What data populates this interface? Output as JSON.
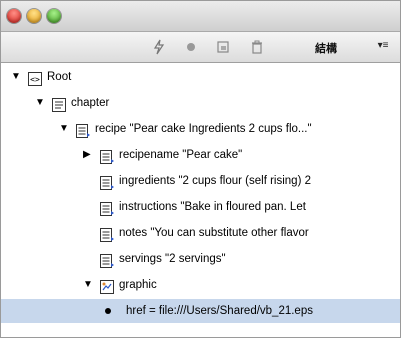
{
  "window": {
    "traffic_lights": [
      "close",
      "minimize",
      "zoom"
    ]
  },
  "toolbar": {
    "buttons": [
      "lightning-icon",
      "record-icon",
      "window-icon",
      "trash-icon"
    ],
    "structure_label": "結構",
    "menu_label": "▾≡"
  },
  "tree": {
    "rows": [
      {
        "label": "Root",
        "icon": "xml-icon",
        "expanded": true
      },
      {
        "label": "chapter",
        "icon": "doc-ab-icon",
        "expanded": true
      },
      {
        "label": "recipe  \"Pear cake Ingredients 2 cups flo...\"",
        "icon": "element-icon",
        "expanded": true
      },
      {
        "label": "recipename  \"Pear cake\"",
        "icon": "element-icon",
        "expanded": false
      },
      {
        "label": "ingredients  \"2 cups flour (self rising) 2",
        "icon": "element-icon"
      },
      {
        "label": "instructions  \"Bake in floured pan. Let",
        "icon": "element-icon"
      },
      {
        "label": "notes  \"You can substitute other flavor",
        "icon": "element-icon"
      },
      {
        "label": "servings  \"2 servings\"",
        "icon": "element-icon"
      },
      {
        "label": "graphic",
        "icon": "graphic-icon",
        "expanded": true
      },
      {
        "label": "href = file:///Users/Shared/vb_21.eps",
        "icon": "bullet",
        "selected": true
      }
    ]
  },
  "colors": {
    "selection": "#c7d7ec"
  }
}
